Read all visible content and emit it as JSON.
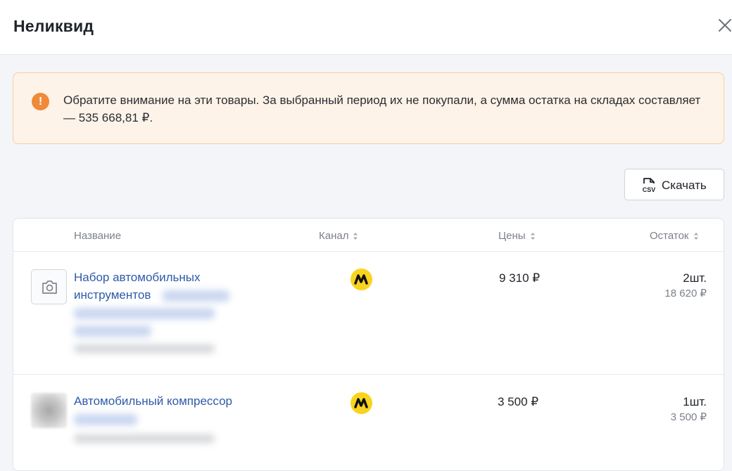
{
  "header": {
    "title": "Неликвид"
  },
  "alert": {
    "icon": "!",
    "text": "Обратите внимание на эти товары. За выбранный период их не покупали, а сумма остатка на складах составляет — 535 668,81 ₽."
  },
  "toolbar": {
    "download_label": "Скачать",
    "download_icon_text": "CSV"
  },
  "table": {
    "columns": {
      "name": "Название",
      "channel": "Канал",
      "price": "Цены",
      "stock": "Остаток"
    },
    "rows": [
      {
        "name_line1": "Набор автомобильных",
        "name_line2": "инструментов",
        "channel_icon": "yandex-market-icon",
        "price": "9 310 ₽",
        "qty": "2шт.",
        "sum": "18 620 ₽"
      },
      {
        "name_line1": "Автомобильный компрессор",
        "channel_icon": "yandex-market-icon",
        "price": "3 500 ₽",
        "qty": "1шт.",
        "sum": "3 500 ₽"
      }
    ]
  },
  "colors": {
    "alert_bg": "#fef3e8",
    "alert_icon": "#ef8a3a",
    "link": "#2e5aa8",
    "channel_yellow": "#f8d41e"
  }
}
